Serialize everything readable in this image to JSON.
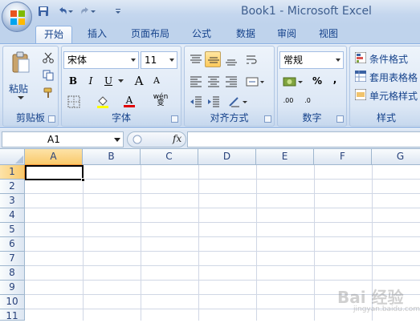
{
  "window": {
    "title": "Book1 - Microsoft Excel"
  },
  "quick_access": {
    "icons": [
      "save-icon",
      "undo-icon",
      "redo-icon",
      "customize-qat-icon"
    ]
  },
  "tabs": [
    {
      "label": "开始",
      "active": true
    },
    {
      "label": "插入"
    },
    {
      "label": "页面布局"
    },
    {
      "label": "公式"
    },
    {
      "label": "数据"
    },
    {
      "label": "审阅"
    },
    {
      "label": "视图"
    }
  ],
  "ribbon": {
    "clipboard": {
      "label": "剪贴板",
      "paste_label": "粘贴"
    },
    "font": {
      "label": "字体",
      "font_name": "宋体",
      "font_size": "11",
      "bold": "B",
      "italic": "I",
      "underline": "U",
      "grow": "A",
      "shrink": "A",
      "font_color": "A",
      "phonetic": "wén 变"
    },
    "alignment": {
      "label": "对齐方式"
    },
    "number": {
      "label": "数字",
      "format": "常规",
      "percent": "%",
      "comma": ",",
      "inc_decimal": ".00",
      "dec_decimal": ".0"
    },
    "styles": {
      "label": "样式",
      "items": [
        "条件格式",
        "套用表格格",
        "单元格样式"
      ]
    }
  },
  "formula_bar": {
    "name_box": "A1",
    "fx": "fx",
    "value": ""
  },
  "sheet": {
    "columns": [
      "A",
      "B",
      "C",
      "D",
      "E",
      "F",
      "G"
    ],
    "rows": [
      "1",
      "2",
      "3",
      "4",
      "5",
      "6",
      "7",
      "8",
      "9",
      "10",
      "11"
    ],
    "selected_cell": "A1"
  },
  "watermark": {
    "text": "Bai 经验",
    "sub": "jingyan.baidu.com"
  },
  "colors": {
    "accent": "#15428b",
    "ribbon_bg": "#dae6f5",
    "header_active": "#f9d886",
    "gridline": "#d0d7e5"
  }
}
